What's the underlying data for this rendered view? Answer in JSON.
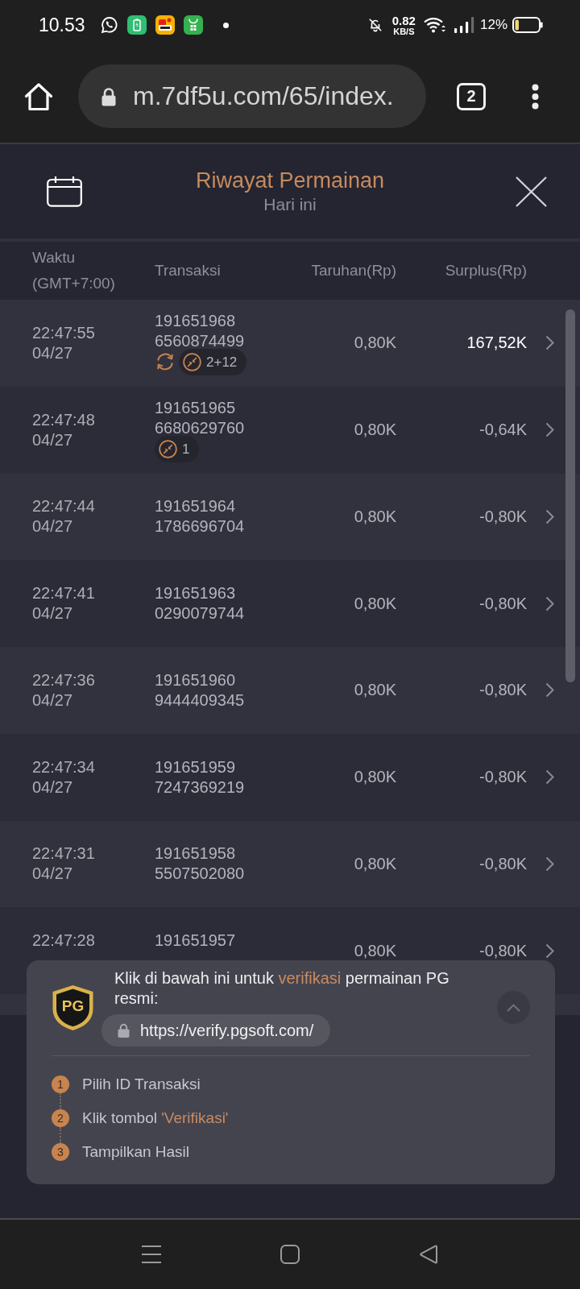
{
  "status_bar": {
    "time": "10.53",
    "net_speed": "0.82",
    "net_unit": "KB/S",
    "battery": "12%"
  },
  "browser": {
    "url": "m.7df5u.com/65/index.",
    "tab_count": "2"
  },
  "header": {
    "title": "Riwayat Permainan",
    "subtitle": "Hari ini"
  },
  "table": {
    "columns": [
      {
        "label": "Waktu",
        "sub": "(GMT+7:00)"
      },
      {
        "label": "Transaksi"
      },
      {
        "label": "Taruhan(Rp)"
      },
      {
        "label": "Surplus(Rp)"
      }
    ],
    "rows": [
      {
        "time": "22:47:55",
        "date": "04/27",
        "transaction": [
          "191651968",
          "6560874499"
        ],
        "tags": [
          {
            "kind": "refresh"
          },
          {
            "kind": "feature",
            "text": "2+12"
          }
        ],
        "bet": "0,80K",
        "surplus": "167,52K",
        "win": true
      },
      {
        "time": "22:47:48",
        "date": "04/27",
        "transaction": [
          "191651965",
          "6680629760"
        ],
        "tags": [
          {
            "kind": "feature",
            "text": "1"
          }
        ],
        "bet": "0,80K",
        "surplus": "-0,64K",
        "win": false
      },
      {
        "time": "22:47:44",
        "date": "04/27",
        "transaction": [
          "191651964",
          "1786696704"
        ],
        "bet": "0,80K",
        "surplus": "-0,80K",
        "win": false
      },
      {
        "time": "22:47:41",
        "date": "04/27",
        "transaction": [
          "191651963",
          "0290079744"
        ],
        "bet": "0,80K",
        "surplus": "-0,80K",
        "win": false
      },
      {
        "time": "22:47:36",
        "date": "04/27",
        "transaction": [
          "191651960",
          "9444409345"
        ],
        "bet": "0,80K",
        "surplus": "-0,80K",
        "win": false
      },
      {
        "time": "22:47:34",
        "date": "04/27",
        "transaction": [
          "191651959",
          "7247369219"
        ],
        "bet": "0,80K",
        "surplus": "-0,80K",
        "win": false
      },
      {
        "time": "22:47:31",
        "date": "04/27",
        "transaction": [
          "191651958",
          "5507502080"
        ],
        "bet": "0,80K",
        "surplus": "-0,80K",
        "win": false
      },
      {
        "time": "22:47:28",
        "transaction": [
          "191651957"
        ],
        "bet": "0,80K",
        "surplus": "-0,80K",
        "win": false
      }
    ]
  },
  "verify_panel": {
    "logo": "PG",
    "message": [
      {
        "text": "Klik di bawah ini untuk ",
        "highlight": false
      },
      {
        "text": "verifikasi",
        "highlight": true
      },
      {
        "text": " permainan PG resmi:",
        "highlight": false
      }
    ],
    "link": "https://verify.pgsoft.com/",
    "steps": [
      {
        "number": "1",
        "parts": [
          {
            "text": "Pilih ID Transaksi",
            "highlight": false
          }
        ]
      },
      {
        "number": "2",
        "parts": [
          {
            "text": "Klik tombol ",
            "highlight": false
          },
          {
            "text": "'Verifikasi'",
            "highlight": true
          }
        ]
      },
      {
        "number": "3",
        "parts": [
          {
            "text": "Tampilkan Hasil",
            "highlight": false
          }
        ]
      }
    ]
  }
}
